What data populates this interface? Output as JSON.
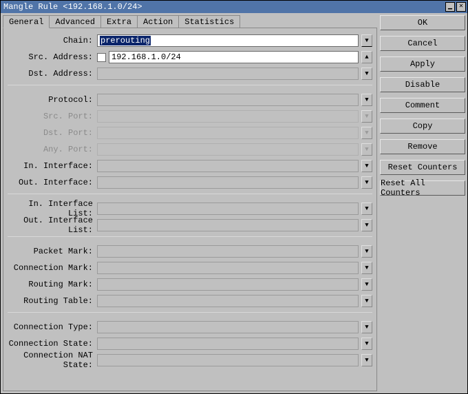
{
  "title": "Mangle Rule <192.168.1.0/24>",
  "tabs": [
    "General",
    "Advanced",
    "Extra",
    "Action",
    "Statistics"
  ],
  "activeTab": 0,
  "fields": {
    "chain": {
      "label": "Chain:",
      "value": "prerouting",
      "selected": true
    },
    "srcAddress": {
      "label": "Src. Address:",
      "value": "192.168.1.0/24",
      "checkbox": true
    },
    "dstAddress": {
      "label": "Dst. Address:"
    },
    "protocol": {
      "label": "Protocol:"
    },
    "srcPort": {
      "label": "Src. Port:",
      "disabled": true
    },
    "dstPort": {
      "label": "Dst. Port:",
      "disabled": true
    },
    "anyPort": {
      "label": "Any. Port:",
      "disabled": true
    },
    "inInterface": {
      "label": "In. Interface:"
    },
    "outInterface": {
      "label": "Out. Interface:"
    },
    "inInterfaceList": {
      "label": "In. Interface List:"
    },
    "outInterfaceList": {
      "label": "Out. Interface List:"
    },
    "packetMark": {
      "label": "Packet Mark:"
    },
    "connectionMark": {
      "label": "Connection Mark:"
    },
    "routingMark": {
      "label": "Routing Mark:"
    },
    "routingTable": {
      "label": "Routing Table:"
    },
    "connectionType": {
      "label": "Connection Type:"
    },
    "connectionState": {
      "label": "Connection State:"
    },
    "connectionNatState": {
      "label": "Connection NAT State:"
    }
  },
  "buttons": {
    "ok": "OK",
    "cancel": "Cancel",
    "apply": "Apply",
    "disable": "Disable",
    "comment": "Comment",
    "copy": "Copy",
    "remove": "Remove",
    "resetCounters": "Reset Counters",
    "resetAllCounters": "Reset All Counters"
  },
  "glyphs": {
    "dropdown": "▼",
    "dropup": "▲",
    "dropdownOverline": "▼",
    "min": "▁",
    "close": "✕"
  }
}
